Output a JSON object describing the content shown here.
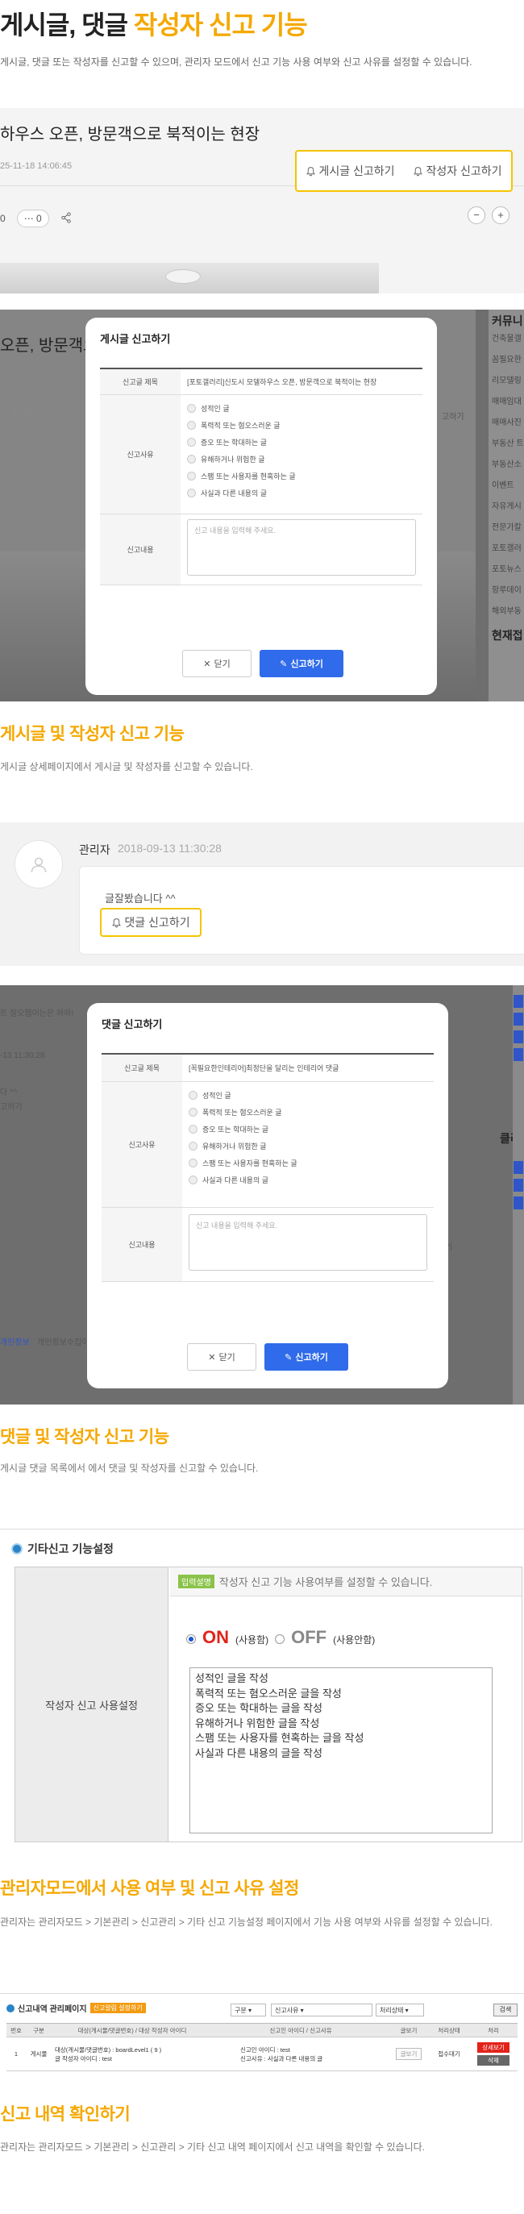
{
  "header": {
    "title_prefix": "게시글, 댓글 ",
    "title_highlight": "작성자 신고 기능",
    "description": "게시글, 댓글 또는 작성자를 신고할 수 있으며, 관리자 모드에서 신고 기능 사용 여부와 신고 사유를 설정할 수 있습니다."
  },
  "post_view": {
    "title": "하우스 오픈, 방문객으로 북적이는 현장",
    "date": "25-11-18 14:06:45",
    "report_post_label": "게시글 신고하기",
    "report_author_label": "작성자 신고하기",
    "count_a": "0",
    "count_b": "0",
    "zoom_out": "−",
    "zoom_in": "+"
  },
  "post_modal": {
    "bg_title": "오픈, 방문객으",
    "bg_date": "14:06:45",
    "bg_right_label": "고하기",
    "sidebar_header": "커뮤니",
    "sidebar_items": [
      "건축물갤",
      "꼼필요한",
      "리모델링",
      "매매임대",
      "매매사진",
      "부동산 트",
      "부동산소",
      "이벤트",
      "자유게시",
      "전문가칼",
      "포토갤러",
      "포토뉴스",
      "항루데이",
      "해외부동"
    ],
    "sidebar_footer": "현재접",
    "heading": "게시글 신고하기",
    "subject_label": "신고글 제목",
    "subject_value": "[포토갤러리]신도시 모델하우스 오픈, 방문객으로 북적이는 현장",
    "reason_label": "신고사유",
    "reasons": [
      "성적인 글",
      "폭력적 또는 혐오스러운 글",
      "증오 또는 학대하는 글",
      "유해하거나 위험한 글",
      "스팸 또는 사용자를 현혹하는 글",
      "사실과 다른 내용의 글"
    ],
    "content_label": "신고내용",
    "content_placeholder": "신고 내용을 입력해 주세요.",
    "close_label": "닫기",
    "submit_label": "신고하기"
  },
  "section_post": {
    "title": "게시글 및 작성자 신고 기능",
    "description": "게시글 상세페이지에서 게시글 및 작성자를 신고할 수 있습니다."
  },
  "comment_view": {
    "author": "관리자",
    "time": "2018-09-13 11:30:28",
    "text": "글잘봤습니다 ^^",
    "report_label": "댓글 신고하기"
  },
  "comment_modal": {
    "bg_lines": [
      "트 잘오햅이는은 하하!",
      "-13 11:30:28",
      "다 ^^",
      "고하기",
      "개인정보",
      "개인정보수집이"
    ],
    "side_label": "클리",
    "bg_right_label": "기",
    "heading": "댓글 신고하기",
    "subject_label": "신고글 제목",
    "subject_value": "[꼭필요한인테리어]최정단을 달리는 인테리어 댓글",
    "reason_label": "신고사유",
    "reasons": [
      "성적인 글",
      "폭력적 또는 혐오스러운 글",
      "증오 또는 학대하는 글",
      "유해하거나 위험한 글",
      "스팸 또는 사용자를 현혹하는 글",
      "사실과 다른 내용의 글"
    ],
    "content_label": "신고내용",
    "content_placeholder": "신고 내용을 입력해 주세요.",
    "close_label": "닫기",
    "submit_label": "신고하기"
  },
  "section_comment": {
    "title": "댓글 및 작성자 신고 기능",
    "description": "게시글 댓글 목록에서 에서 댓글 및 작성자를 신고할 수 있습니다."
  },
  "admin_settings": {
    "header": "기타신고 기능설정",
    "help_tag": "입력설명",
    "help_text": "작성자 신고 기능 사용여부를 설정할 수 있습니다.",
    "on_label": "ON",
    "on_sub": "(사용함)",
    "off_label": "OFF",
    "off_sub": "(사용안함)",
    "row_label": "작성자 신고 사용설정",
    "reasons_text": "성적인 글을 작성\n폭력적 또는 혐오스러운 글을 작성\n증오 또는 학대하는 글을 작성\n유해하거나 위험한 글을 작성\n스팸 또는 사용자를 현혹하는 글을 작성\n사실과 다른 내용의 글을 작성"
  },
  "section_admin": {
    "title": "관리자모드에서 사용 여부 및 신고 사유 설정",
    "description": "관리자는 관리자모드 > 기본관리 > 신고관리 > 기타 신고 기능설정 페이지에서 기능 사용 여부와 사유를 설정할 수 있습니다."
  },
  "report_list": {
    "header": "신고내역 관리페이지",
    "tag": "신고알림 설정하기",
    "filter1": "구분",
    "filter2": "신고사유",
    "filter3": "처리상태",
    "search_label": "검색",
    "columns": [
      "번호",
      "구분",
      "대상(게시물/댓글번호) / 대상 작성자 아이디",
      "신고인 아이디 / 신고사유",
      "글보기",
      "처리상태",
      "처리"
    ],
    "row": {
      "no": "1",
      "type": "게시물",
      "target_line1": "대상(게시물/댓글번호) : boardLevel1 ( 9 )",
      "target_line2": "글 작성자 아이디 : test",
      "reporter_line1": "신고인 아이디 : test",
      "reporter_line2": "신고사유 : 사실과 다른 내용의 글",
      "view_label": "글보기",
      "status": "접수대기",
      "action1": "상세보기",
      "action2": "삭제"
    }
  },
  "section_list": {
    "title": "신고 내역 확인하기",
    "description": "관리자는 관리자모드 > 기본관리 > 신고관리 > 기타 신고 내역 페이지에서 신고 내역을 확인할 수 있습니다."
  }
}
